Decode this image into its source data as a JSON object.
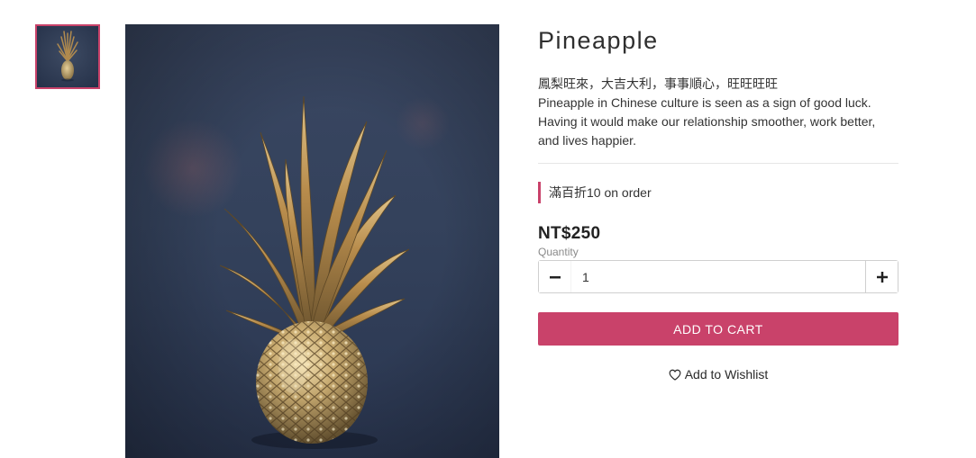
{
  "gallery": {
    "thumbnail_alt": "Pineapple thumbnail",
    "main_image_alt": "Golden pineapple on dark blue background",
    "accent": "#c9426a"
  },
  "product": {
    "title": "Pineapple",
    "description_lines": [
      "鳳梨旺來，大吉大利，事事順心，旺旺旺旺",
      "Pineapple in Chinese culture is seen as a sign of good luck.",
      "Having it would make our relationship smoother, work better,",
      "and lives happier."
    ],
    "promo": "滿百折10 on order",
    "price": "NT$250"
  },
  "quantity": {
    "label": "Quantity",
    "value": "1",
    "minus_icon": "minus-icon",
    "plus_icon": "plus-icon"
  },
  "actions": {
    "add_to_cart": "ADD TO CART",
    "wishlist": "Add to Wishlist",
    "wishlist_icon": "heart-outline-icon",
    "button_color": "#c9426a"
  }
}
